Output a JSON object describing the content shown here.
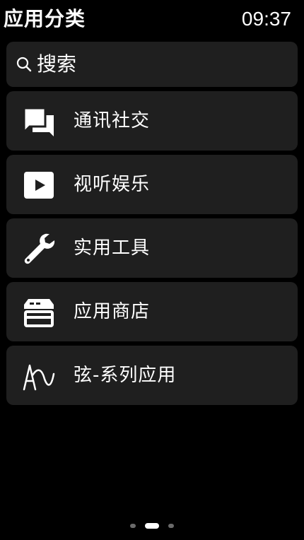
{
  "header": {
    "title": "应用分类",
    "time": "09:37"
  },
  "search": {
    "label": "搜索",
    "icon": "search-icon"
  },
  "categories": [
    {
      "label": "通讯社交",
      "icon": "chat-bubbles-icon"
    },
    {
      "label": "视听娱乐",
      "icon": "play-icon"
    },
    {
      "label": "实用工具",
      "icon": "wrench-icon"
    },
    {
      "label": "应用商店",
      "icon": "store-icon"
    },
    {
      "label": "弦-系列应用",
      "icon": "waveform-icon"
    }
  ],
  "pager": {
    "page_count": 3,
    "current_page": 2
  },
  "colors": {
    "background": "#000000",
    "card": "#1f1f1f",
    "text": "#ffffff",
    "dot_inactive": "#6a6a6a",
    "dot_active": "#ffffff"
  }
}
